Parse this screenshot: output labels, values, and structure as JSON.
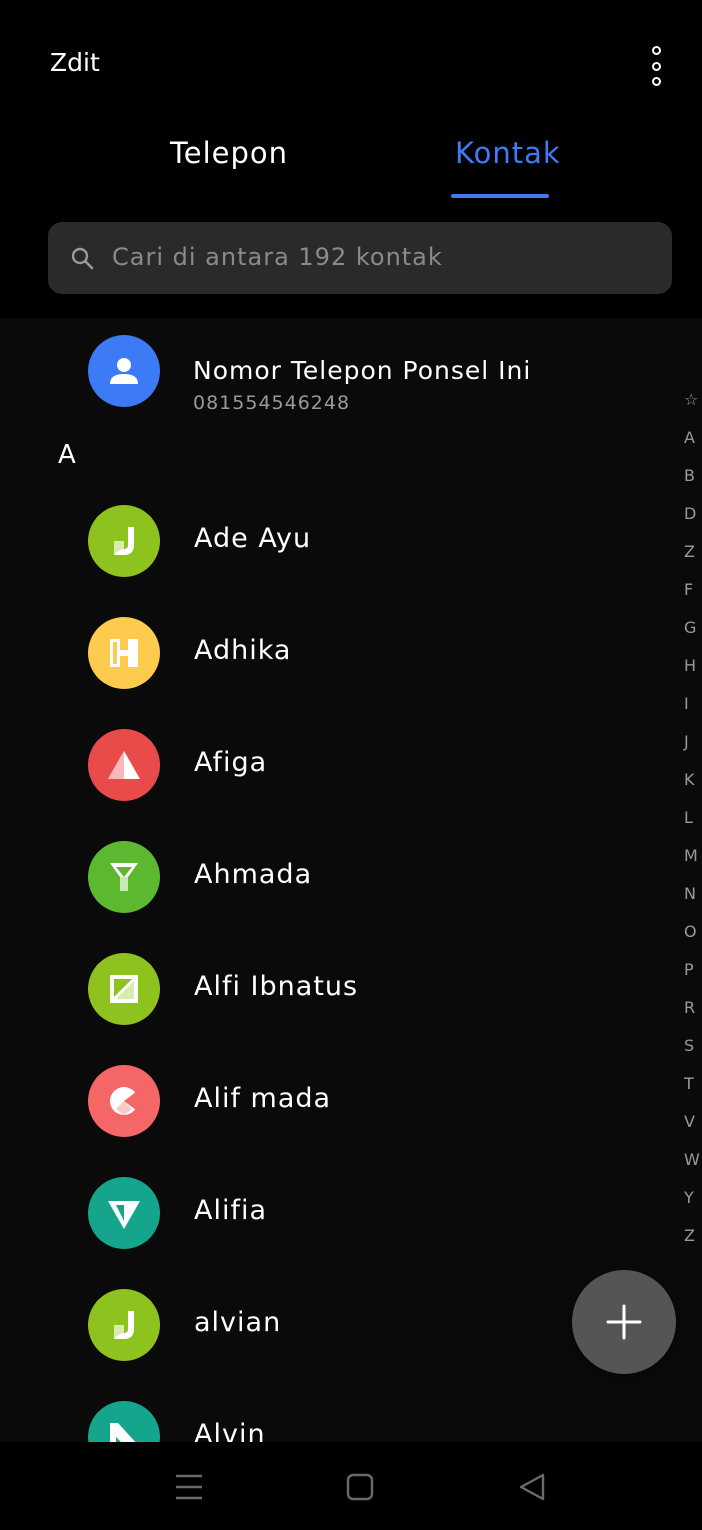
{
  "header": {
    "edit_label": "Zdit",
    "more_icon": "more-vertical-icon"
  },
  "tabs": [
    {
      "label": "Telepon",
      "active": false
    },
    {
      "label": "Kontak",
      "active": true
    }
  ],
  "search": {
    "placeholder": "Cari di antara 192 kontak",
    "icon": "search-icon"
  },
  "my_phone": {
    "name": "Nomor Telepon Ponsel Ini",
    "number": "081554546248",
    "avatar_color": "#3d7bf6"
  },
  "section": {
    "letter": "A"
  },
  "contacts": [
    {
      "name": "Ade Ayu",
      "avatar_color": "#8dc21f",
      "avatar_icon": "j-shape-icon"
    },
    {
      "name": "Adhika",
      "avatar_color": "#ffcb4f",
      "avatar_icon": "h-shape-icon"
    },
    {
      "name": "Afiga",
      "avatar_color": "#e94b4b",
      "avatar_icon": "triangle-icon"
    },
    {
      "name": "Ahmada",
      "avatar_color": "#5cb82e",
      "avatar_icon": "y-shape-icon"
    },
    {
      "name": "Alfi Ibnatus",
      "avatar_color": "#8dc21f",
      "avatar_icon": "z-shape-icon"
    },
    {
      "name": "Alif mada",
      "avatar_color": "#f56767",
      "avatar_icon": "c-shape-icon"
    },
    {
      "name": "Alifia",
      "avatar_color": "#14a58c",
      "avatar_icon": "v-shape-icon"
    },
    {
      "name": "alvian",
      "avatar_color": "#8dc21f",
      "avatar_icon": "j-shape-icon"
    },
    {
      "name": "Alvin",
      "avatar_color": "#14a58c",
      "avatar_icon": "n-shape-icon"
    }
  ],
  "alpha_index": [
    "☆",
    "A",
    "B",
    "D",
    "Z",
    "F",
    "G",
    "H",
    "I",
    "J",
    "K",
    "L",
    "M",
    "N",
    "O",
    "P",
    "R",
    "S",
    "T",
    "V",
    "W",
    "Y",
    "Z"
  ],
  "fab": {
    "icon": "plus-icon"
  },
  "navbar": {
    "icons": [
      "menu-icon",
      "home-icon",
      "back-icon"
    ]
  },
  "colors": {
    "accent": "#3f7bf5",
    "background": "#000000",
    "list_background": "#0a0a0a"
  }
}
